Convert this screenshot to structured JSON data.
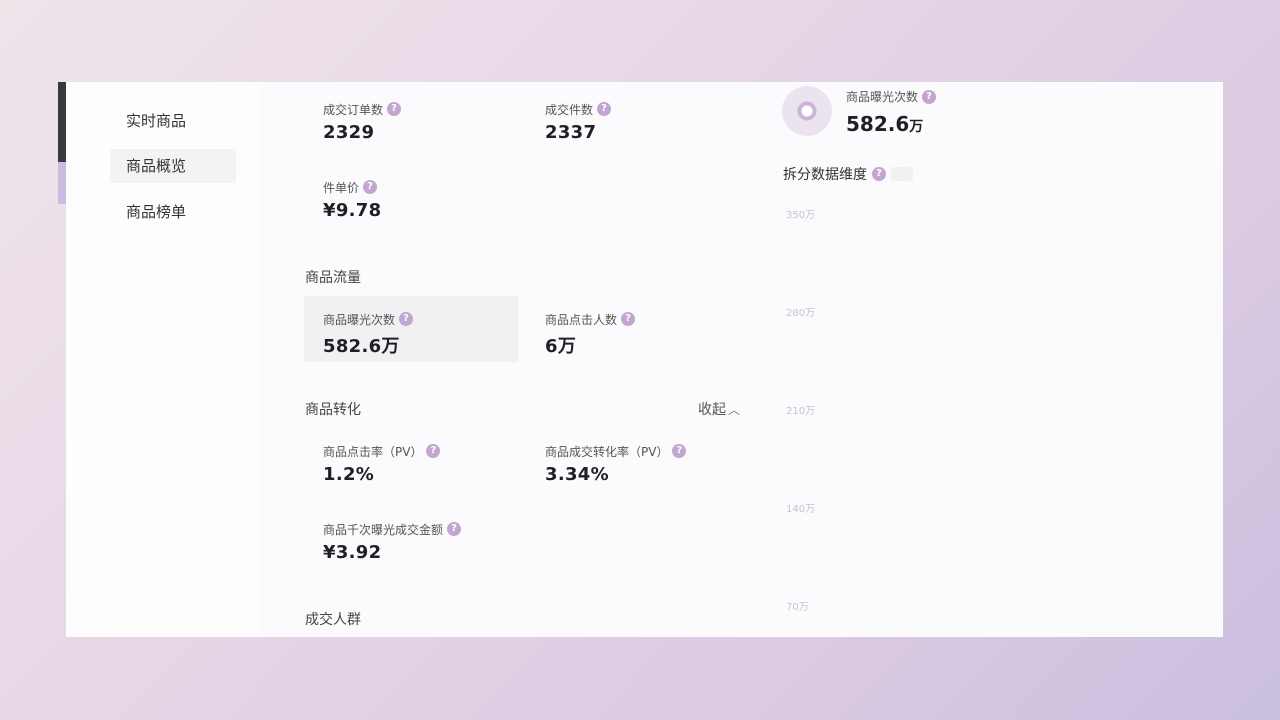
{
  "sidebar": {
    "items": [
      {
        "label": "实时商品"
      },
      {
        "label": "商品概览"
      },
      {
        "label": "商品榜单"
      }
    ]
  },
  "transaction": {
    "orders_label": "成交订单数",
    "orders_value": "2329",
    "items_label": "成交件数",
    "items_value": "2337",
    "unit_price_label": "件单价",
    "unit_price_value": "¥9.78"
  },
  "traffic": {
    "title": "商品流量",
    "exposure_label": "商品曝光次数",
    "exposure_value": "582.6万",
    "clicks_label": "商品点击人数",
    "clicks_value": "6万"
  },
  "conversion": {
    "title": "商品转化",
    "collapse_label": "收起",
    "ctr_label": "商品点击率（PV）",
    "ctr_value": "1.2%",
    "cvr_label": "商品成交转化率（PV）",
    "cvr_value": "3.34%",
    "gpm_label": "商品千次曝光成交金额",
    "gpm_value": "¥3.92"
  },
  "audience": {
    "title": "成交人群"
  },
  "right_panel": {
    "metric_label": "商品曝光次数",
    "metric_value": "582.6",
    "metric_unit": "万",
    "split_title": "拆分数据维度",
    "ticks": [
      "350万",
      "280万",
      "210万",
      "140万",
      "70万"
    ]
  },
  "icons": {
    "help": "question-circle-icon",
    "chevron": "chevron-up-icon",
    "ring": "ring-chart-icon"
  },
  "colors": {
    "accent": "#c2a6cf",
    "window_bg": "#fbfbfd"
  }
}
